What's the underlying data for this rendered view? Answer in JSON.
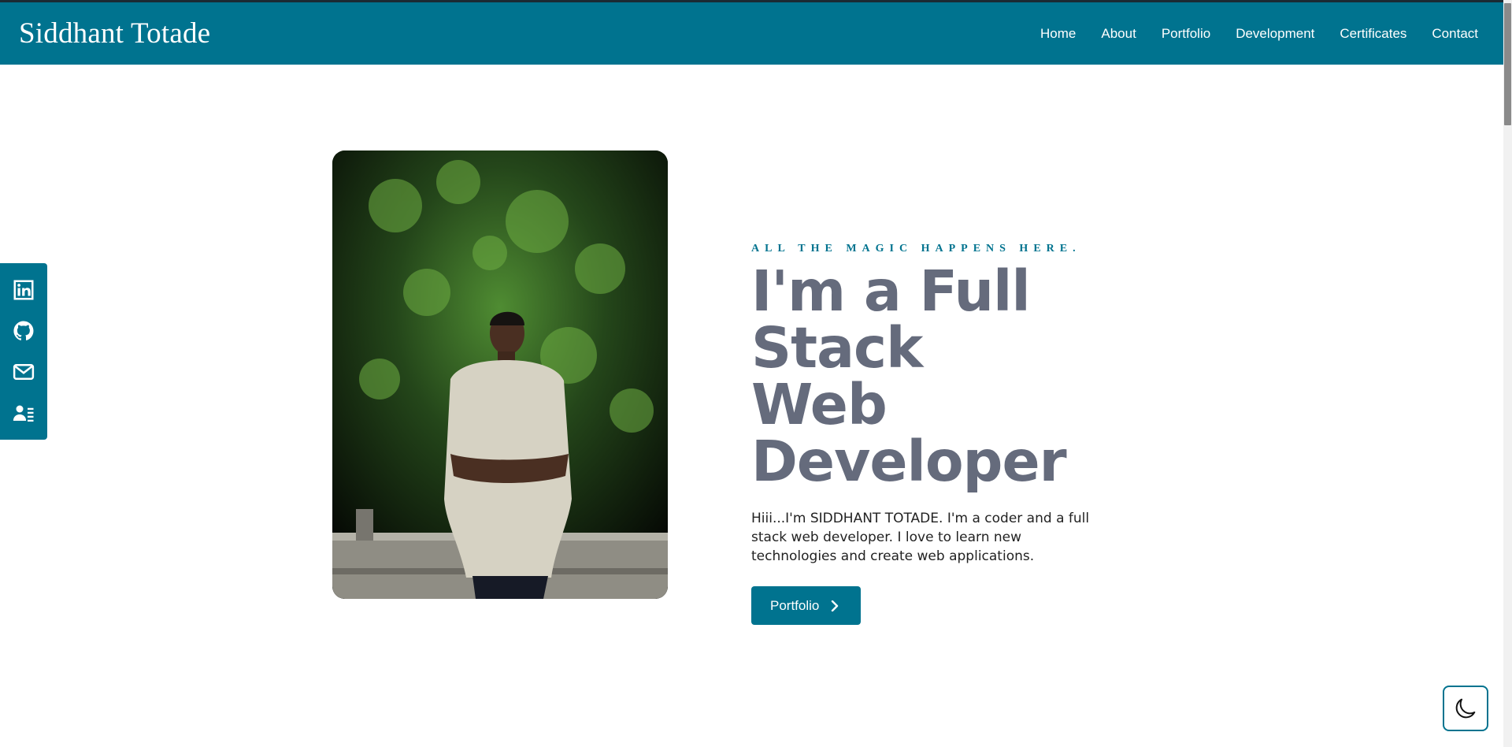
{
  "brand": {
    "name": "Siddhant Totade"
  },
  "nav": {
    "links": [
      {
        "label": "Home"
      },
      {
        "label": "About"
      },
      {
        "label": "Portfolio"
      },
      {
        "label": "Development"
      },
      {
        "label": "Certificates"
      },
      {
        "label": "Contact"
      }
    ]
  },
  "social": {
    "items": [
      {
        "icon": "linkedin-icon"
      },
      {
        "icon": "github-icon"
      },
      {
        "icon": "mail-icon"
      },
      {
        "icon": "resume-icon"
      }
    ]
  },
  "hero": {
    "eyebrow": "ALL THE MAGIC HAPPENS HERE.",
    "headline_line1": "I'm a Full Stack",
    "headline_line2": "Web Developer",
    "intro": "Hiii...I'm SIDDHANT TOTADE. I'm a coder and a full stack web developer. I love to learn new technologies and create web applications.",
    "cta_label": "Portfolio",
    "cta_icon": "chevron-right-icon",
    "photo_icon": "profile-photo"
  },
  "theme_toggle": {
    "icon": "moon-icon"
  },
  "colors": {
    "primary": "#00738f",
    "headline": "#656b7c",
    "text": "#222222",
    "background": "#ffffff"
  }
}
